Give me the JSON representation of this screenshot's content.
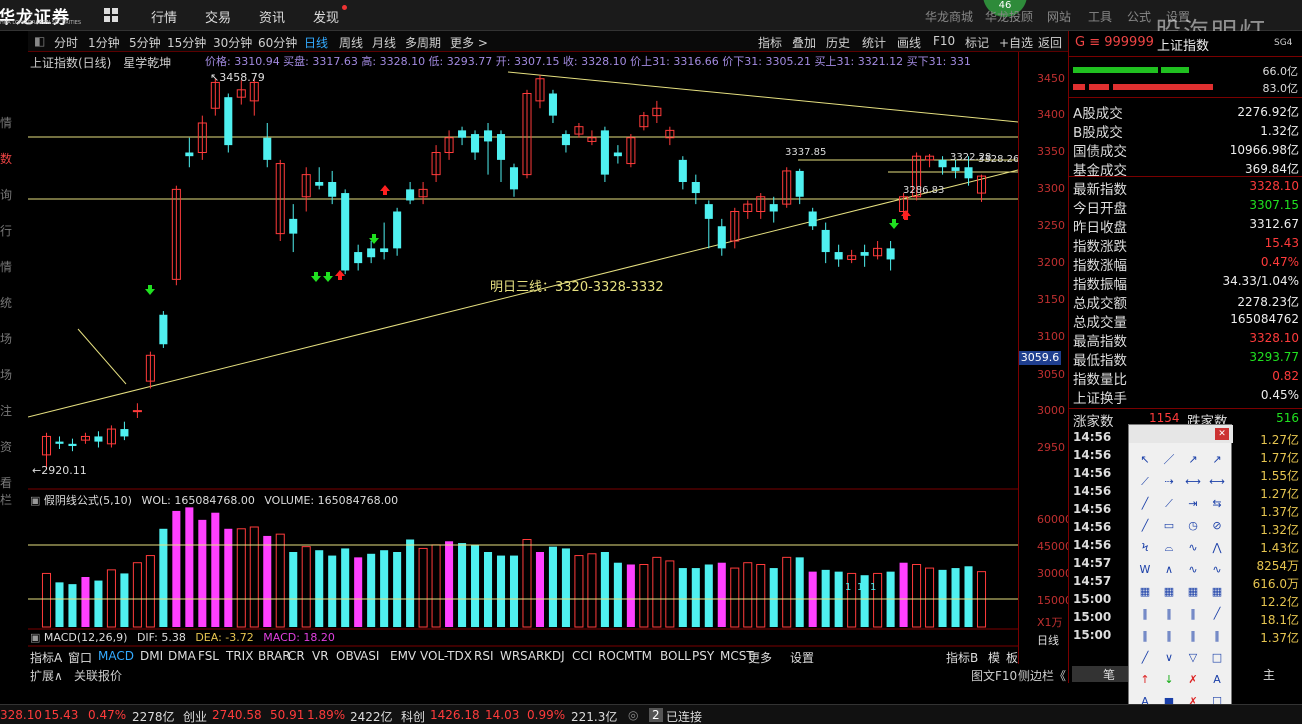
{
  "topbar": {
    "logo": "华龙证券",
    "logo_sub": "HUA LONG DRAGON SECURITIES",
    "nav": [
      "行情",
      "交易",
      "资讯",
      "发现"
    ],
    "badge": "46",
    "right": [
      "华龙商城",
      "华龙投顾",
      "网站",
      "工具",
      "公式",
      "设置"
    ],
    "watermark": "股海明灯"
  },
  "toolbar": {
    "periods": [
      "分时",
      "1分钟",
      "5分钟",
      "15分钟",
      "30分钟",
      "60分钟",
      "日线",
      "周线",
      "月线",
      "多周期",
      "更多 >"
    ],
    "right": [
      "指标",
      "叠加",
      "历史",
      "统计",
      "画线",
      "F10",
      "标记",
      "+自选",
      "返回"
    ]
  },
  "sidebar": [
    "情",
    "数",
    "询",
    "行",
    "情",
    "统",
    "场",
    "场",
    "注",
    "资",
    "看栏"
  ],
  "chart_info": {
    "name": "上证指数(日线)",
    "style": "星学乾坤",
    "ticker": "价格: 3310.94  买盘: 3317.63  高: 3328.10  低: 3293.77  开: 3307.15  收: 3328.10  价上31: 3316.66  价下31: 3305.21  买上31: 3321.12  买下31: 331"
  },
  "annotations": {
    "high": "3458.79",
    "low": "2920.11",
    "forecast": "明日三线：3320-3328-3332",
    "p1": "3337.85",
    "p2": "3286.83",
    "p3": "3322.28",
    "p4": "3328.26"
  },
  "current_price": "3059.6",
  "y_labels": [
    "3450",
    "3400",
    "3350",
    "3300",
    "3250",
    "3200",
    "3150",
    "3100",
    "3050",
    "3000",
    "2950"
  ],
  "vol_labels": [
    "60000",
    "45000",
    "30000",
    "15000",
    "X1万"
  ],
  "vol_info": {
    "name": "假阴线公式(5,10)",
    "wol": "WOL: 165084768.00",
    "volume": "VOLUME: 165084768.00"
  },
  "macd_info": {
    "name": "MACD(12,26,9)",
    "dif": "DIF: 5.38",
    "dea": "DEA: -3.72",
    "macd": "MACD: 18.20",
    "period": "日线"
  },
  "bottom_tabs": [
    "指标A",
    "窗口",
    "MACD",
    "DMI",
    "DMA",
    "FSL",
    "TRIX",
    "BRAR",
    "CR",
    "VR",
    "OBV",
    "ASI",
    "EMV",
    "VOL-TDX",
    "RSI",
    "WR",
    "SAR",
    "KDJ",
    "CCI",
    "ROC",
    "MTM",
    "BOLL",
    "PSY",
    "MCST",
    "更多",
    "设置"
  ],
  "bottom_right": [
    "指标B",
    "模",
    "板"
  ],
  "ext_tabs": [
    "扩展∧",
    "关联报价"
  ],
  "ext_right": [
    "图文F10",
    "侧边栏《"
  ],
  "right_panel": {
    "code": "G ≡ 999999",
    "name": "上证指数",
    "sg": "SG4",
    "bars": [
      {
        "v": "66.0亿"
      },
      {
        "v": "83.0亿"
      }
    ],
    "rows": [
      {
        "k": "A股成交",
        "v": "2276.92亿",
        "c": "white"
      },
      {
        "k": "B股成交",
        "v": "1.32亿",
        "c": "white"
      },
      {
        "k": "国债成交",
        "v": "10966.98亿",
        "c": "white"
      },
      {
        "k": "基金成交",
        "v": "369.84亿",
        "c": "white"
      },
      {
        "k": "最新指数",
        "v": "3328.10",
        "c": "red"
      },
      {
        "k": "今日开盘",
        "v": "3307.15",
        "c": "green"
      },
      {
        "k": "昨日收盘",
        "v": "3312.67",
        "c": "white"
      },
      {
        "k": "指数涨跌",
        "v": "15.43",
        "c": "red"
      },
      {
        "k": "指数涨幅",
        "v": "0.47%",
        "c": "red"
      },
      {
        "k": "指数振幅",
        "v": "34.33/1.04%",
        "c": "white"
      },
      {
        "k": "总成交额",
        "v": "2278.23亿",
        "c": "white"
      },
      {
        "k": "总成交量",
        "v": "165084762",
        "c": "white"
      },
      {
        "k": "最高指数",
        "v": "3328.10",
        "c": "red"
      },
      {
        "k": "最低指数",
        "v": "3293.77",
        "c": "green"
      },
      {
        "k": "指数量比",
        "v": "0.82",
        "c": "red"
      },
      {
        "k": "上证换手",
        "v": "0.45%",
        "c": "white"
      }
    ],
    "updown": {
      "up_label": "涨家数",
      "up": "1154",
      "down_label": "跌家数",
      "down": "516"
    },
    "ticks": [
      {
        "t": "14:56",
        "v": "1.27亿"
      },
      {
        "t": "14:56",
        "v": "1.77亿"
      },
      {
        "t": "14:56",
        "v": "1.55亿"
      },
      {
        "t": "14:56",
        "v": "1.27亿"
      },
      {
        "t": "14:56",
        "v": "1.37亿"
      },
      {
        "t": "14:56",
        "v": "1.32亿"
      },
      {
        "t": "14:56",
        "v": "1.43亿"
      },
      {
        "t": "14:57",
        "v": "8254万"
      },
      {
        "t": "14:57",
        "v": "616.0万"
      },
      {
        "t": "15:00",
        "v": "12.2亿"
      },
      {
        "t": "15:00",
        "v": "18.1亿"
      },
      {
        "t": "15:00",
        "v": "1.37亿"
      }
    ],
    "bottom": [
      "笔",
      "价",
      "主"
    ]
  },
  "status": {
    "idx1": "328.10",
    "idx1_chg": "15.43",
    "idx1_pct": "0.47%",
    "idx1_amt": "2278亿",
    "idx2_name": "创业",
    "idx2": "2740.58",
    "idx2_chg": "50.91",
    "idx2_pct": "1.89%",
    "idx2_amt": "2422亿",
    "idx3_name": "科创",
    "idx3": "1426.18",
    "idx3_chg": "14.03",
    "idx3_pct": "0.99%",
    "idx3_amt": "221.3亿",
    "conn": "已连接",
    "conn_num": "2"
  },
  "chart_data": {
    "type": "candlestick",
    "ylim": [
      2920,
      3480
    ],
    "candles": [
      [
        2950,
        2975,
        2980,
        2930
      ],
      [
        2968,
        2965,
        2975,
        2958
      ],
      [
        2965,
        2962,
        2972,
        2955
      ],
      [
        2970,
        2975,
        2980,
        2965
      ],
      [
        2975,
        2968,
        2982,
        2960
      ],
      [
        2965,
        2985,
        2990,
        2960
      ],
      [
        2985,
        2975,
        2995,
        2970
      ],
      [
        3010,
        3010,
        3020,
        3000
      ],
      [
        3050,
        3085,
        3090,
        3040
      ],
      [
        3140,
        3100,
        3145,
        3095
      ],
      [
        3188,
        3310,
        3315,
        3180
      ],
      [
        3360,
        3355,
        3380,
        3340
      ],
      [
        3360,
        3400,
        3410,
        3350
      ],
      [
        3420,
        3455,
        3460,
        3410
      ],
      [
        3435,
        3370,
        3440,
        3360
      ],
      [
        3435,
        3445,
        3458,
        3425
      ],
      [
        3430,
        3455,
        3460,
        3410
      ],
      [
        3380,
        3350,
        3400,
        3340
      ],
      [
        3250,
        3345,
        3350,
        3240
      ],
      [
        3270,
        3250,
        3290,
        3225
      ],
      [
        3300,
        3330,
        3340,
        3280
      ],
      [
        3320,
        3315,
        3340,
        3310
      ],
      [
        3320,
        3300,
        3335,
        3290
      ],
      [
        3305,
        3200,
        3310,
        3195
      ],
      [
        3225,
        3210,
        3235,
        3200
      ],
      [
        3230,
        3218,
        3240,
        3210
      ],
      [
        3230,
        3225,
        3265,
        3215
      ],
      [
        3280,
        3230,
        3285,
        3220
      ],
      [
        3310,
        3295,
        3320,
        3290
      ],
      [
        3300,
        3310,
        3320,
        3290
      ],
      [
        3330,
        3360,
        3370,
        3320
      ],
      [
        3360,
        3380,
        3390,
        3350
      ],
      [
        3390,
        3380,
        3395,
        3370
      ],
      [
        3385,
        3360,
        3390,
        3350
      ],
      [
        3390,
        3375,
        3400,
        3330
      ],
      [
        3385,
        3350,
        3390,
        3320
      ],
      [
        3340,
        3310,
        3345,
        3300
      ],
      [
        3330,
        3440,
        3445,
        3325
      ],
      [
        3430,
        3460,
        3465,
        3420
      ],
      [
        3440,
        3410,
        3445,
        3400
      ],
      [
        3385,
        3370,
        3390,
        3360
      ],
      [
        3385,
        3395,
        3400,
        3380
      ],
      [
        3375,
        3380,
        3390,
        3370
      ],
      [
        3390,
        3330,
        3395,
        3320
      ],
      [
        3360,
        3355,
        3370,
        3345
      ],
      [
        3345,
        3380,
        3385,
        3340
      ],
      [
        3395,
        3410,
        3415,
        3390
      ],
      [
        3410,
        3420,
        3430,
        3400
      ],
      [
        3380,
        3390,
        3395,
        3370
      ],
      [
        3350,
        3320,
        3355,
        3310
      ],
      [
        3320,
        3305,
        3330,
        3290
      ],
      [
        3290,
        3270,
        3295,
        3230
      ],
      [
        3260,
        3230,
        3270,
        3220
      ],
      [
        3240,
        3280,
        3285,
        3230
      ],
      [
        3280,
        3290,
        3295,
        3270
      ],
      [
        3280,
        3300,
        3305,
        3270
      ],
      [
        3290,
        3280,
        3300,
        3265
      ],
      [
        3290,
        3335,
        3340,
        3285
      ],
      [
        3335,
        3300,
        3338,
        3290
      ],
      [
        3280,
        3260,
        3285,
        3255
      ],
      [
        3255,
        3225,
        3265,
        3210
      ],
      [
        3225,
        3215,
        3235,
        3205
      ],
      [
        3215,
        3220,
        3228,
        3210
      ],
      [
        3225,
        3220,
        3235,
        3205
      ],
      [
        3220,
        3230,
        3240,
        3215
      ],
      [
        3230,
        3215,
        3240,
        3200
      ],
      [
        3280,
        3300,
        3305,
        3270
      ],
      [
        3300,
        3355,
        3360,
        3295
      ],
      [
        3350,
        3355,
        3358,
        3340
      ],
      [
        3350,
        3340,
        3355,
        3330
      ],
      [
        3340,
        3335,
        3350,
        3325
      ],
      [
        3340,
        3325,
        3355,
        3315
      ],
      [
        3305,
        3328,
        3330,
        3293
      ]
    ],
    "volumes": [
      30,
      25,
      24,
      28,
      26,
      32,
      30,
      36,
      40,
      55,
      65,
      67,
      60,
      64,
      55,
      55,
      56,
      51,
      52,
      42,
      45,
      43,
      40,
      44,
      39,
      41,
      43,
      42,
      49,
      44,
      46,
      48,
      47,
      46,
      42,
      40,
      40,
      49,
      42,
      45,
      44,
      40,
      41,
      42,
      36,
      35,
      35,
      39,
      37,
      33,
      33,
      35,
      36,
      33,
      36,
      35,
      33,
      39,
      39,
      31,
      32,
      31,
      30,
      29,
      30,
      31,
      36,
      35,
      33,
      32,
      33,
      34,
      31
    ]
  }
}
